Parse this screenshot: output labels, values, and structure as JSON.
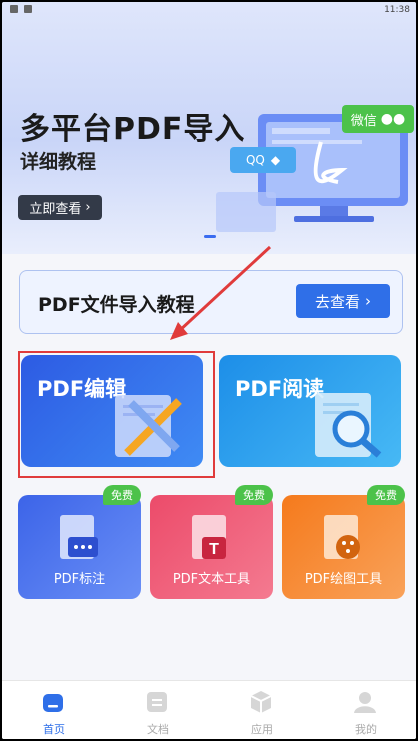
{
  "status_bar": {
    "time": "11:38"
  },
  "hero": {
    "title": "多平台PDF导入",
    "subtitle": "详细教程",
    "button_label": "立即查看",
    "wechat_label": "微信",
    "qq_label": "QQ"
  },
  "tutorial": {
    "label": "PDF文件导入教程",
    "button_label": "去查看"
  },
  "cards": [
    {
      "label": "PDF编辑"
    },
    {
      "label": "PDF阅读"
    }
  ],
  "tools": [
    {
      "label": "PDF标注",
      "badge": "免费"
    },
    {
      "label": "PDF文本工具",
      "badge": "免费"
    },
    {
      "label": "PDF绘图工具",
      "badge": "免费"
    }
  ],
  "tabs": [
    {
      "label": "首页",
      "active": true
    },
    {
      "label": "文档",
      "active": false
    },
    {
      "label": "应用",
      "active": false
    },
    {
      "label": "我的",
      "active": false
    }
  ],
  "colors": {
    "accent": "#2f6fe8",
    "highlight": "#e03b3b",
    "free_badge": "#4cc24a"
  }
}
